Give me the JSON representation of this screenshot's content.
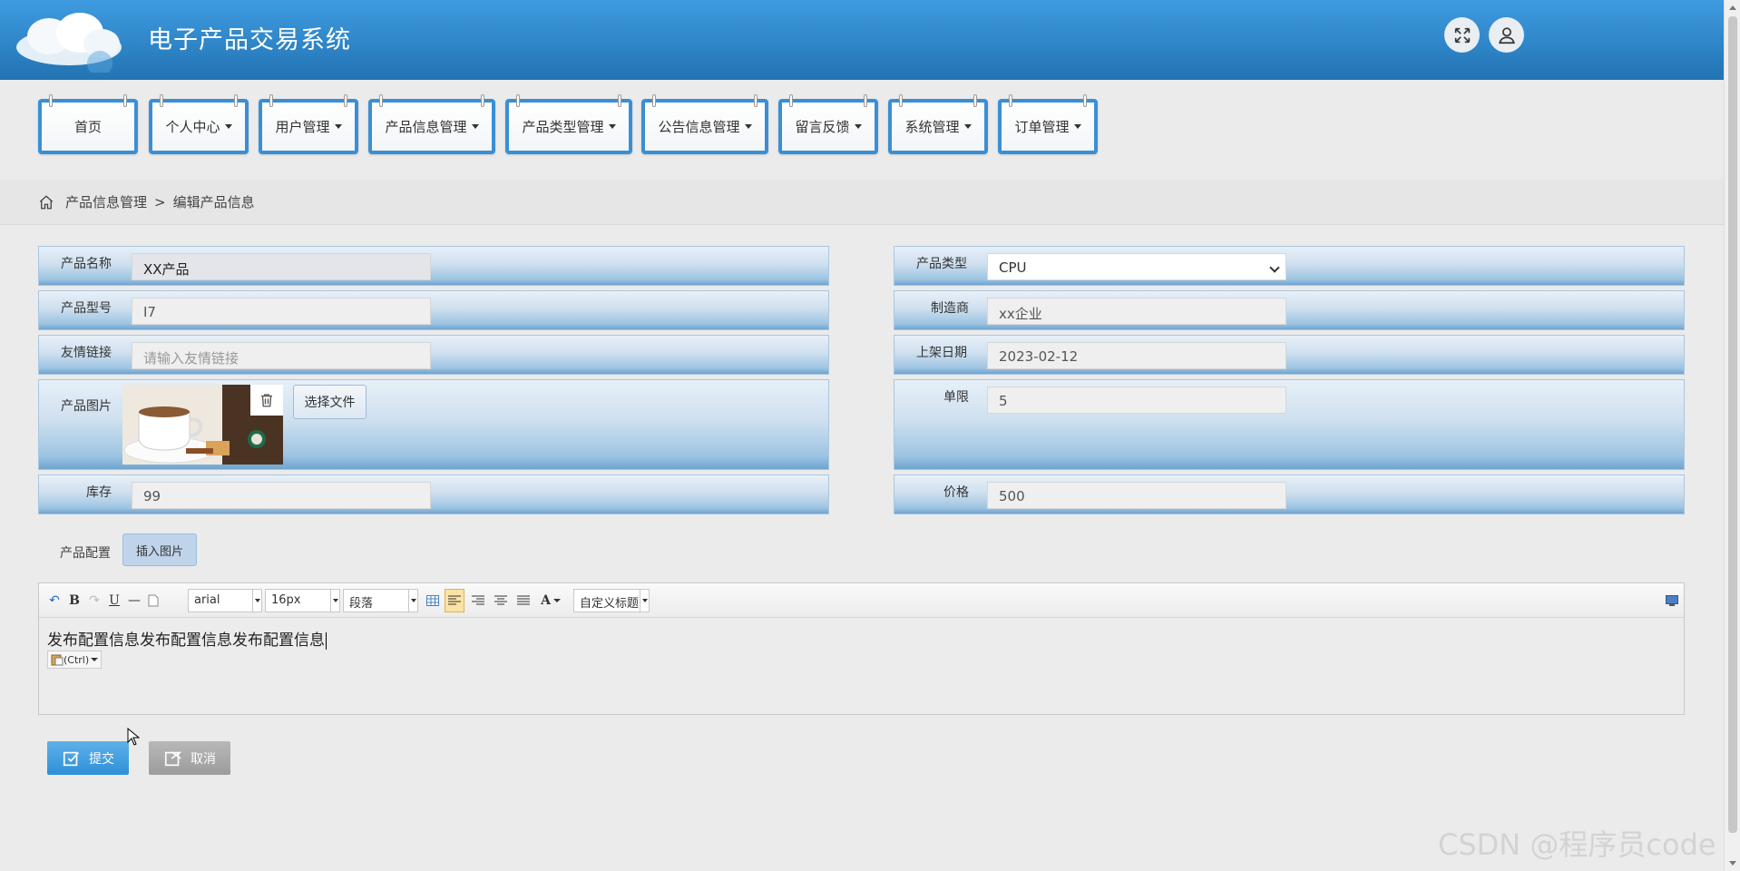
{
  "app": {
    "title": "电子产品交易系统"
  },
  "header": {
    "fullscreen_icon": "fullscreen-icon",
    "user_icon": "user-icon"
  },
  "nav": {
    "items": [
      {
        "label": "首页",
        "dropdown": false
      },
      {
        "label": "个人中心",
        "dropdown": true
      },
      {
        "label": "用户管理",
        "dropdown": true
      },
      {
        "label": "产品信息管理",
        "dropdown": true
      },
      {
        "label": "产品类型管理",
        "dropdown": true
      },
      {
        "label": "公告信息管理",
        "dropdown": true
      },
      {
        "label": "留言反馈",
        "dropdown": true
      },
      {
        "label": "系统管理",
        "dropdown": true
      },
      {
        "label": "订单管理",
        "dropdown": true
      }
    ]
  },
  "breadcrumb": {
    "section": "产品信息管理",
    "separator": ">",
    "current": "编辑产品信息"
  },
  "form": {
    "name": {
      "label": "产品名称",
      "value": "XX产品"
    },
    "type": {
      "label": "产品类型",
      "value": "CPU"
    },
    "model": {
      "label": "产品型号",
      "value": "I7"
    },
    "maker": {
      "label": "制造商",
      "value": "xx企业"
    },
    "link": {
      "label": "友情链接",
      "placeholder": "请输入友情链接"
    },
    "date": {
      "label": "上架日期",
      "value": "2023-02-12"
    },
    "image": {
      "label": "产品图片",
      "choose_file": "选择文件"
    },
    "limit": {
      "label": "单限",
      "value": "5"
    },
    "stock": {
      "label": "库存",
      "value": "99"
    },
    "price": {
      "label": "价格",
      "value": "500"
    },
    "config": {
      "label": "产品配置",
      "insert_image": "插入图片"
    }
  },
  "editor": {
    "font": "arial",
    "size": "16px",
    "paragraph": "段落",
    "custom_title": "自定义标题",
    "content": "发布配置信息发布配置信息发布配置信息",
    "paste_hint": "(Ctrl)"
  },
  "buttons": {
    "submit": "提交",
    "cancel": "取消"
  },
  "watermark": "CSDN @程序员code",
  "colors": {
    "header": "#2f86c8",
    "nav_border": "#3a8fd4",
    "submit": "#3a98dc",
    "cancel": "#a9a9a9"
  }
}
